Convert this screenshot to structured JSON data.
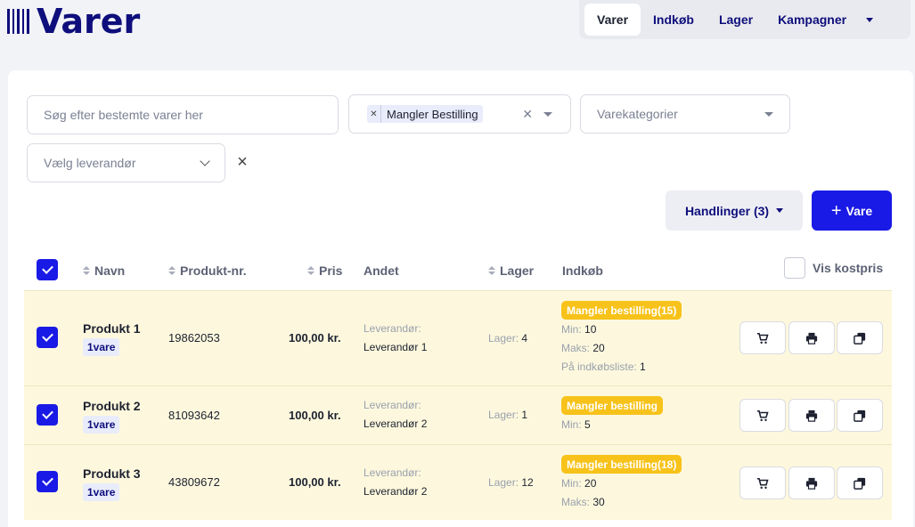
{
  "app": {
    "title": "Varer"
  },
  "nav": {
    "tabs": [
      {
        "label": "Varer",
        "active": true
      },
      {
        "label": "Indkøb"
      },
      {
        "label": "Lager"
      },
      {
        "label": "Kampagner"
      }
    ]
  },
  "filters": {
    "search_placeholder": "Søg efter bestemte varer her",
    "status_tag": "Mangler Bestilling",
    "category_placeholder": "Varekategorier",
    "supplier_placeholder": "Vælg leverandør"
  },
  "toolbar": {
    "actions_label": "Handlinger (3)",
    "add_label": "Vare",
    "add_icon": "+"
  },
  "columns": {
    "navn": "Navn",
    "produkt_nr": "Produkt-nr.",
    "pris": "Pris",
    "andet": "Andet",
    "lager": "Lager",
    "indkob": "Indkøb",
    "vis_kostpris": "Vis kostpris"
  },
  "rows": [
    {
      "name": "Produkt 1",
      "badge": "1vare",
      "sku": "19862053",
      "price": "100,00 kr.",
      "supplier_label": "Leverandør:",
      "supplier": "Leverandør 1",
      "stock_label": "Lager:",
      "stock": "4",
      "status": "Mangler bestilling(15)",
      "min_label": "Min:",
      "min": "10",
      "max_label": "Maks:",
      "max": "20",
      "list_label": "På indkøbsliste:",
      "list": "1",
      "checked": true
    },
    {
      "name": "Produkt 2",
      "badge": "1vare",
      "sku": "81093642",
      "price": "100,00 kr.",
      "supplier_label": "Leverandør:",
      "supplier": "Leverandør 2",
      "stock_label": "Lager:",
      "stock": "1",
      "status": "Mangler bestilling",
      "min_label": "Min:",
      "min": "5",
      "checked": true
    },
    {
      "name": "Produkt 3",
      "badge": "1vare",
      "sku": "43809672",
      "price": "100,00 kr.",
      "supplier_label": "Leverandør:",
      "supplier": "Leverandør 2",
      "stock_label": "Lager:",
      "stock": "12",
      "status": "Mangler bestilling(18)",
      "min_label": "Min:",
      "min": "20",
      "max_label": "Maks:",
      "max": "30",
      "checked": true
    }
  ],
  "colors": {
    "brand": "#0e0e7c",
    "primary": "#1a1ae6",
    "warning": "#f7c21a",
    "row_highlight": "#fdf8dd"
  },
  "row_action_icons": [
    "cart-icon",
    "printer-icon",
    "copy-icon"
  ]
}
